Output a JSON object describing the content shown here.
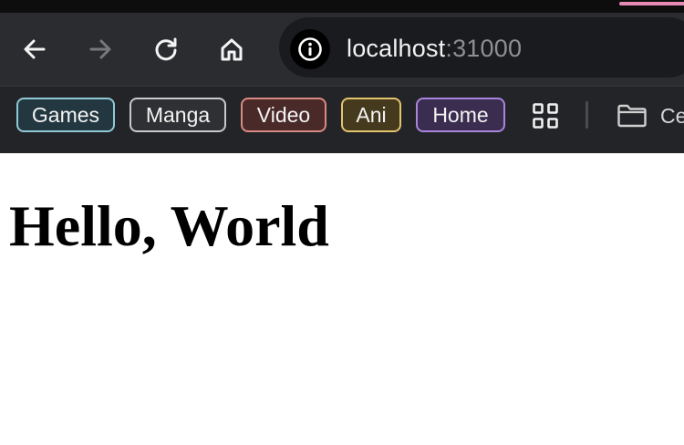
{
  "browser": {
    "accent_color": "#e58ab4",
    "nav": {
      "back_icon": "arrow-left-icon",
      "forward_icon": "arrow-right-icon",
      "reload_icon": "reload-icon",
      "home_icon": "home-icon"
    },
    "urlbar": {
      "info_icon": "info-icon",
      "host": "localhost",
      "port": ":31000"
    },
    "bookmarks": [
      {
        "label": "Games",
        "border": "#8fc9d4",
        "bg": "#233740"
      },
      {
        "label": "Manga",
        "border": "#c9c9c9",
        "bg": "#2f3033"
      },
      {
        "label": "Video",
        "border": "#d98b83",
        "bg": "#4a2a28"
      },
      {
        "label": "Ani",
        "border": "#e3c46e",
        "bg": "#453a1d"
      },
      {
        "label": "Home",
        "border": "#a985dd",
        "bg": "#3b2d4f"
      }
    ],
    "apps_icon": "grid-icon",
    "folder": {
      "icon": "folder-icon",
      "label": "Ce"
    }
  },
  "page": {
    "heading": "Hello, World"
  }
}
